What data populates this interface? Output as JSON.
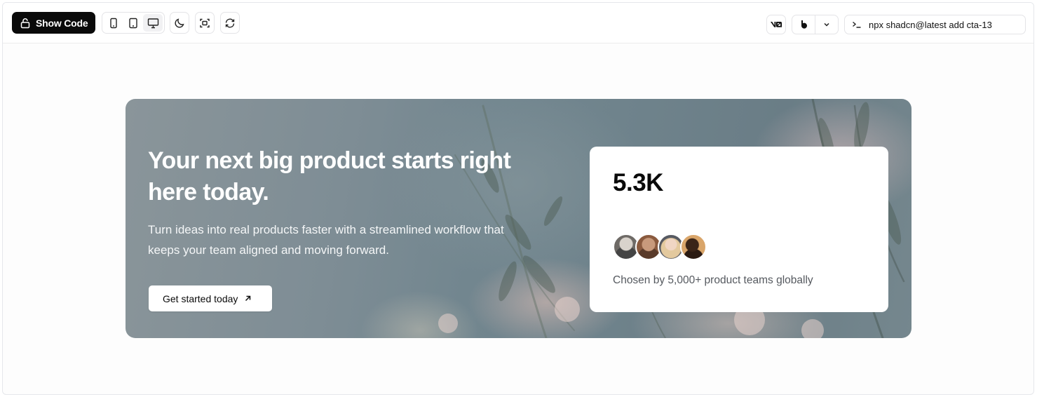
{
  "toolbar": {
    "show_code_label": "Show Code",
    "device_buttons": [
      {
        "icon": "phone-icon",
        "active": false
      },
      {
        "icon": "tablet-icon",
        "active": false
      },
      {
        "icon": "desktop-icon",
        "active": true
      }
    ],
    "icon_buttons": [
      "moon-icon",
      "fullscreen-icon",
      "refresh-icon"
    ],
    "v0_button_icon": "v0-logo-icon",
    "split_button_icons": [
      "bolt-logo-icon",
      "chevron-down-icon"
    ],
    "command": "npx shadcn@latest add cta-13",
    "command_prompt_icon": "terminal-prompt-icon"
  },
  "hero": {
    "title": "Your next big product starts right here today.",
    "subtitle": "Turn ideas into real products faster with a streamlined workflow that keeps your team aligned and moving forward.",
    "cta_label": "Get started today",
    "cta_icon": "arrow-up-right-icon",
    "stat": {
      "value": "5.3K",
      "caption": "Chosen by 5,000+ product teams globally",
      "avatars": [
        "avatar-1",
        "avatar-2",
        "avatar-3",
        "avatar-4"
      ]
    }
  },
  "colors": {
    "primary_button_bg": "#0a0a0a",
    "hero_tone": "#72868f",
    "card_bg": "#ffffff",
    "caption_text": "#55595f"
  }
}
